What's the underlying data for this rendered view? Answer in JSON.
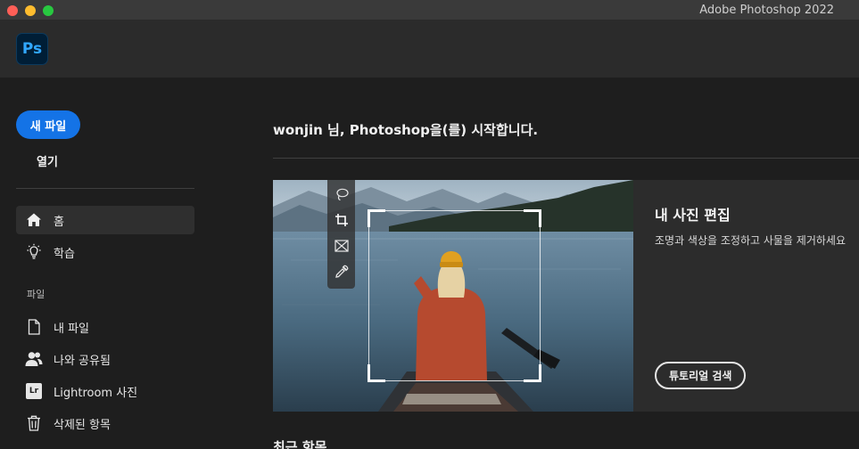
{
  "window": {
    "app_title": "Adobe Photoshop 2022"
  },
  "appbar": {
    "logo_text": "Ps"
  },
  "sidebar": {
    "new_file_label": "새 파일",
    "open_label": "열기",
    "nav_items": [
      {
        "label": "홈",
        "icon": "home-icon",
        "active": true
      },
      {
        "label": "학습",
        "icon": "lightbulb-icon",
        "active": false
      }
    ],
    "files_section_label": "파일",
    "file_items": [
      {
        "label": "내 파일",
        "icon": "document-icon"
      },
      {
        "label": "나와 공유됨",
        "icon": "people-icon"
      },
      {
        "label": "Lightroom 사진",
        "icon": "lightroom-icon",
        "icon_text": "Lr"
      },
      {
        "label": "삭제된 항목",
        "icon": "trash-icon"
      }
    ]
  },
  "main": {
    "welcome_text": "wonjin 님, Photoshop을(를) 시작합니다.",
    "feature_card": {
      "title": "내 사진 편집",
      "description": "조명과 색상을 조정하고 사물을 제거하세요",
      "button_label": "튜토리얼 검색",
      "tools": [
        "lasso-icon",
        "crop-icon",
        "frame-icon",
        "eyedropper-icon"
      ]
    },
    "recent_title": "최근 항목"
  },
  "colors": {
    "accent_blue": "#1473e6",
    "ps_logo_bg": "#001e36",
    "ps_logo_text": "#31a8ff"
  }
}
